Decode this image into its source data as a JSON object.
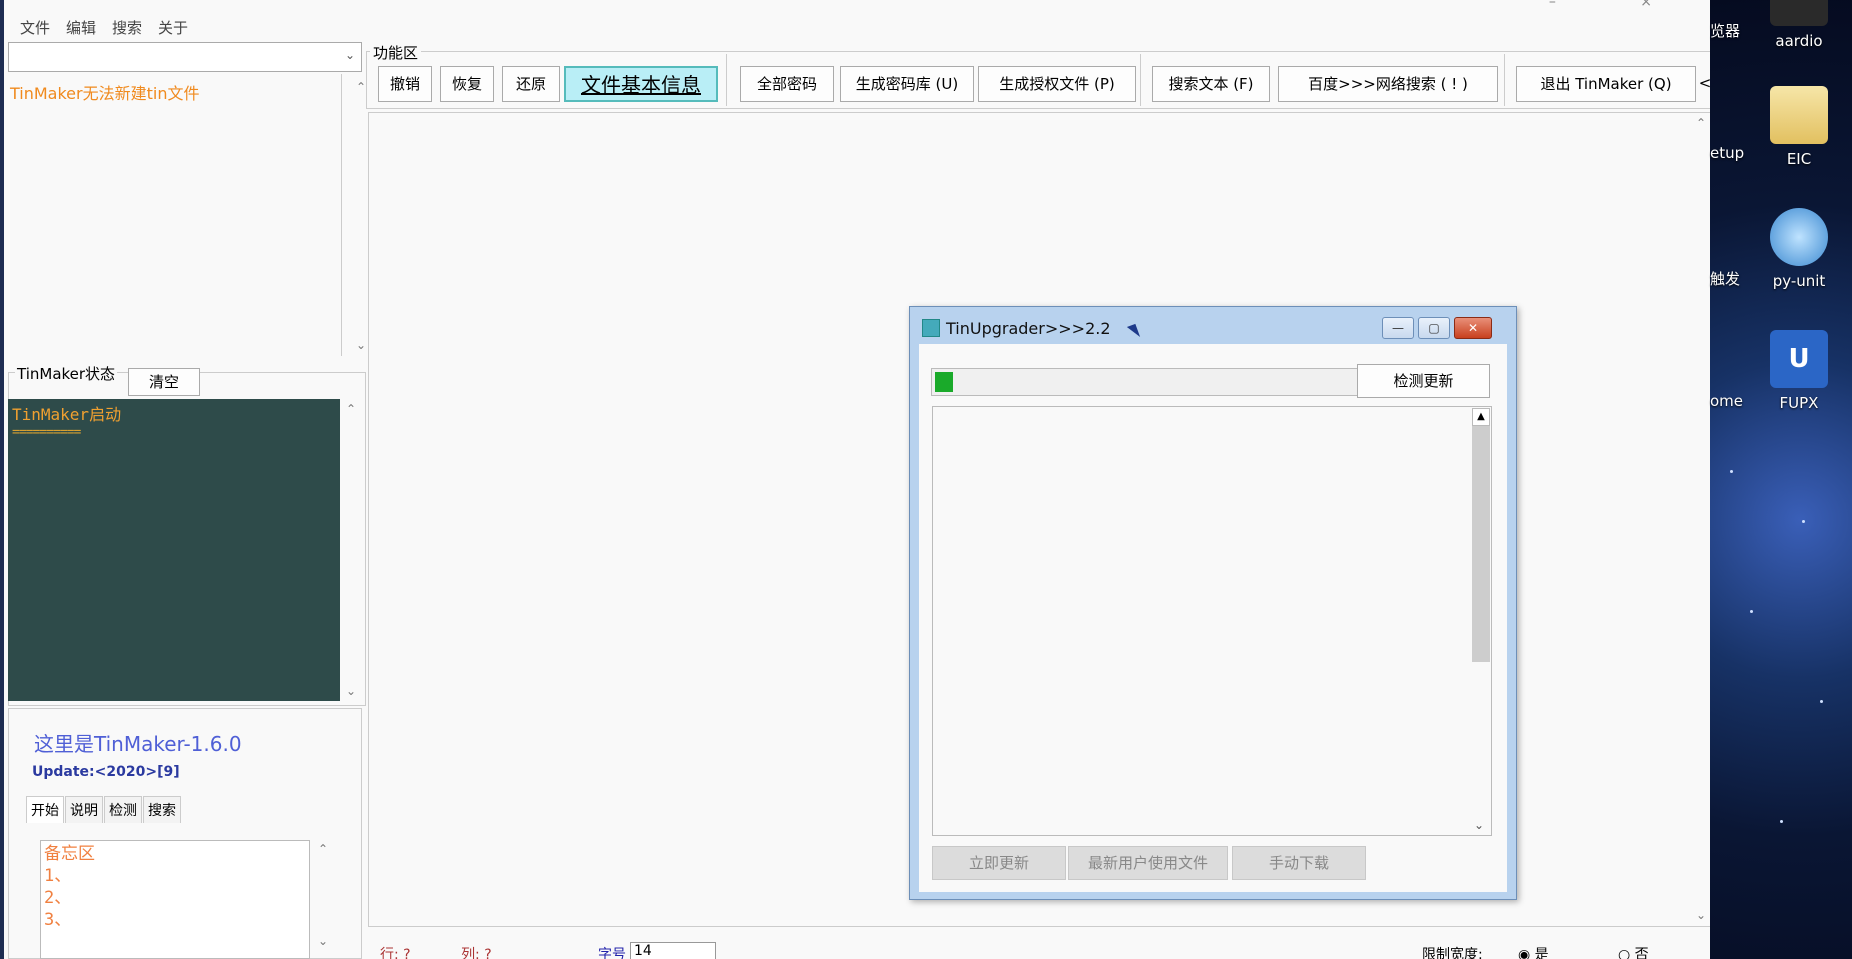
{
  "menu": [
    "文件",
    "编辑",
    "搜索",
    "关于"
  ],
  "file_list": {
    "message": "TinMaker无法新建tin文件"
  },
  "status_panel": {
    "legend": "TinMaker状态",
    "clear_label": "清空",
    "console_lines": [
      "TinMaker启动",
      "=========="
    ]
  },
  "info": {
    "app_name": "这里是TinMaker-1.6.0",
    "update": "Update:<2020>[9]",
    "tabs": [
      "开始",
      "说明",
      "检测",
      "搜索"
    ],
    "memo_lines": [
      "备忘区",
      "1、",
      "2、",
      "3、"
    ]
  },
  "func_area": {
    "legend": "功能区",
    "buttons": [
      "撤销",
      "恢复",
      "还原",
      "文件基本信息",
      "全部密码",
      "生成密码库 (U)",
      "生成授权文件 (P)",
      "搜索文本 (F)",
      "百度>>>网络搜索 ( ! )",
      "退出 TinMaker (Q)"
    ],
    "more": "<"
  },
  "status_bar": {
    "row_label": "行: ?",
    "col_label": "列: ?",
    "font_label": "字号",
    "font_size": "14",
    "limit_label": "限制宽度:",
    "yes": "是",
    "no": "否"
  },
  "dialog": {
    "title": "TinUpgrader>>>2.2",
    "check_label": "检测更新",
    "progress": 0.04,
    "buttons": [
      "立即更新",
      "最新用户使用文件",
      "手动下载"
    ]
  },
  "desktop": {
    "icons": [
      {
        "label": "aardio",
        "icon": "aardio-icon"
      },
      {
        "label": "EIC",
        "icon": "folder-icon"
      },
      {
        "label": "py-unit",
        "icon": "globe-icon"
      },
      {
        "label": "FUPX",
        "icon": "upx-icon"
      }
    ],
    "partial_labels": [
      "览器",
      "etup",
      "触发",
      "ome"
    ]
  },
  "colors": {
    "console_bg": "#2e4b4a",
    "console_text": "#f0a030",
    "highlight_button": "#b9eef6",
    "progress": "#1aaa2a",
    "app_name": "#4f5fd6"
  }
}
